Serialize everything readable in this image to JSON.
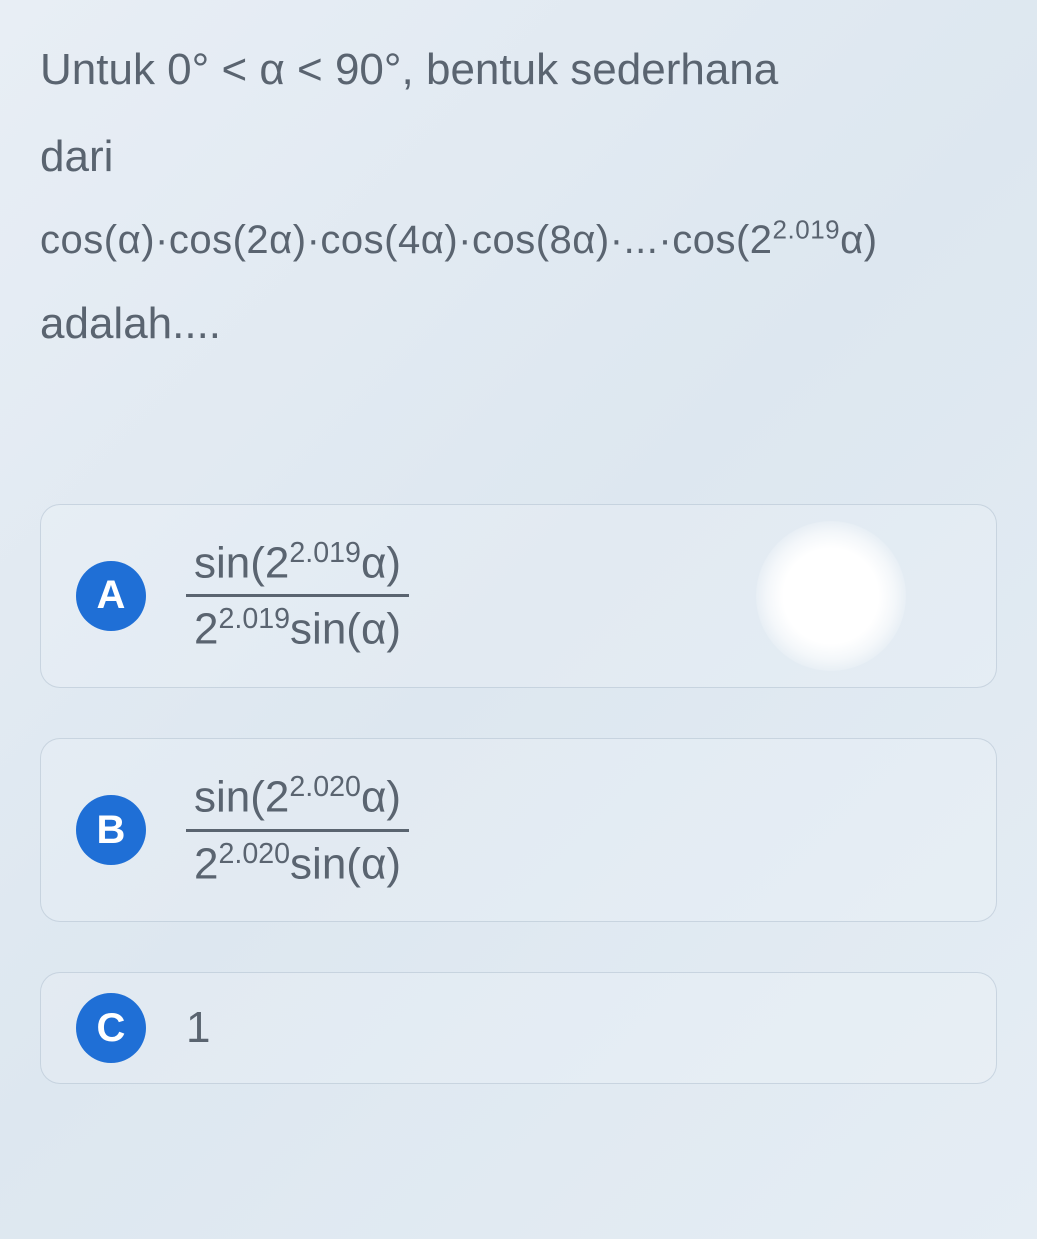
{
  "question": {
    "line1_prefix": "Untuk ",
    "line1_math": "0° < α < 90°,",
    "line1_suffix": " bentuk sederhana",
    "line2": "dari",
    "line3_math": "cos(α)·cos(2α)·cos(4α)·cos(8α)·...·cos(2",
    "line3_exp": "2.019",
    "line3_tail": "α)",
    "line4": "adalah...."
  },
  "options": {
    "A": {
      "label": "A",
      "num_pre": "sin(2",
      "num_exp": "2.019",
      "num_post": "α)",
      "den_pre": "2",
      "den_exp": "2.019",
      "den_post": "sin(α)"
    },
    "B": {
      "label": "B",
      "num_pre": "sin(2",
      "num_exp": "2.020",
      "num_post": "α)",
      "den_pre": "2",
      "den_exp": "2.020",
      "den_post": "sin(α)"
    },
    "C": {
      "label": "C",
      "value": "1"
    }
  }
}
